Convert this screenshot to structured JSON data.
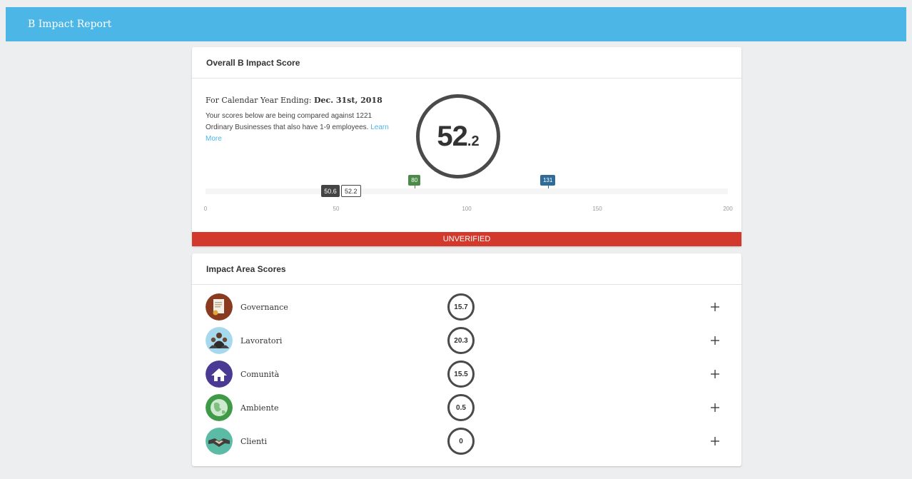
{
  "app": {
    "title": "B Impact Report"
  },
  "overall": {
    "header": "Overall B Impact Score",
    "year_label": "For Calendar Year Ending:",
    "year_value": "Dec. 31st, 2018",
    "description": "Your scores below are being compared against 1221 Ordinary Businesses that also have 1-9 employees.",
    "learn_more": "Learn More",
    "score_int": "52",
    "score_dec": ".2",
    "markers": [
      {
        "value": 50.6,
        "label": "50.6",
        "style": "dark"
      },
      {
        "value": 52.2,
        "label": "52.2",
        "style": "outline"
      },
      {
        "value": 80,
        "label": "80",
        "style": "green"
      },
      {
        "value": 131,
        "label": "131",
        "style": "blue"
      }
    ],
    "ticks": [
      "0",
      "50",
      "100",
      "150",
      "200"
    ],
    "range": [
      0,
      200
    ],
    "status": "UNVERIFIED"
  },
  "areas": {
    "header": "Impact Area Scores",
    "items": [
      {
        "name": "Governance",
        "score": "15.7",
        "icon": "governance-icon",
        "color": "#8a3a1e"
      },
      {
        "name": "Lavoratori",
        "score": "20.3",
        "icon": "workers-icon",
        "color": "#a6d8ee"
      },
      {
        "name": "Comunità",
        "score": "15.5",
        "icon": "community-icon",
        "color": "#4a3a93"
      },
      {
        "name": "Ambiente",
        "score": "0.5",
        "icon": "environment-icon",
        "color": "#3f9a48"
      },
      {
        "name": "Clienti",
        "score": "0",
        "icon": "customers-icon",
        "color": "#5bbba4"
      }
    ]
  }
}
